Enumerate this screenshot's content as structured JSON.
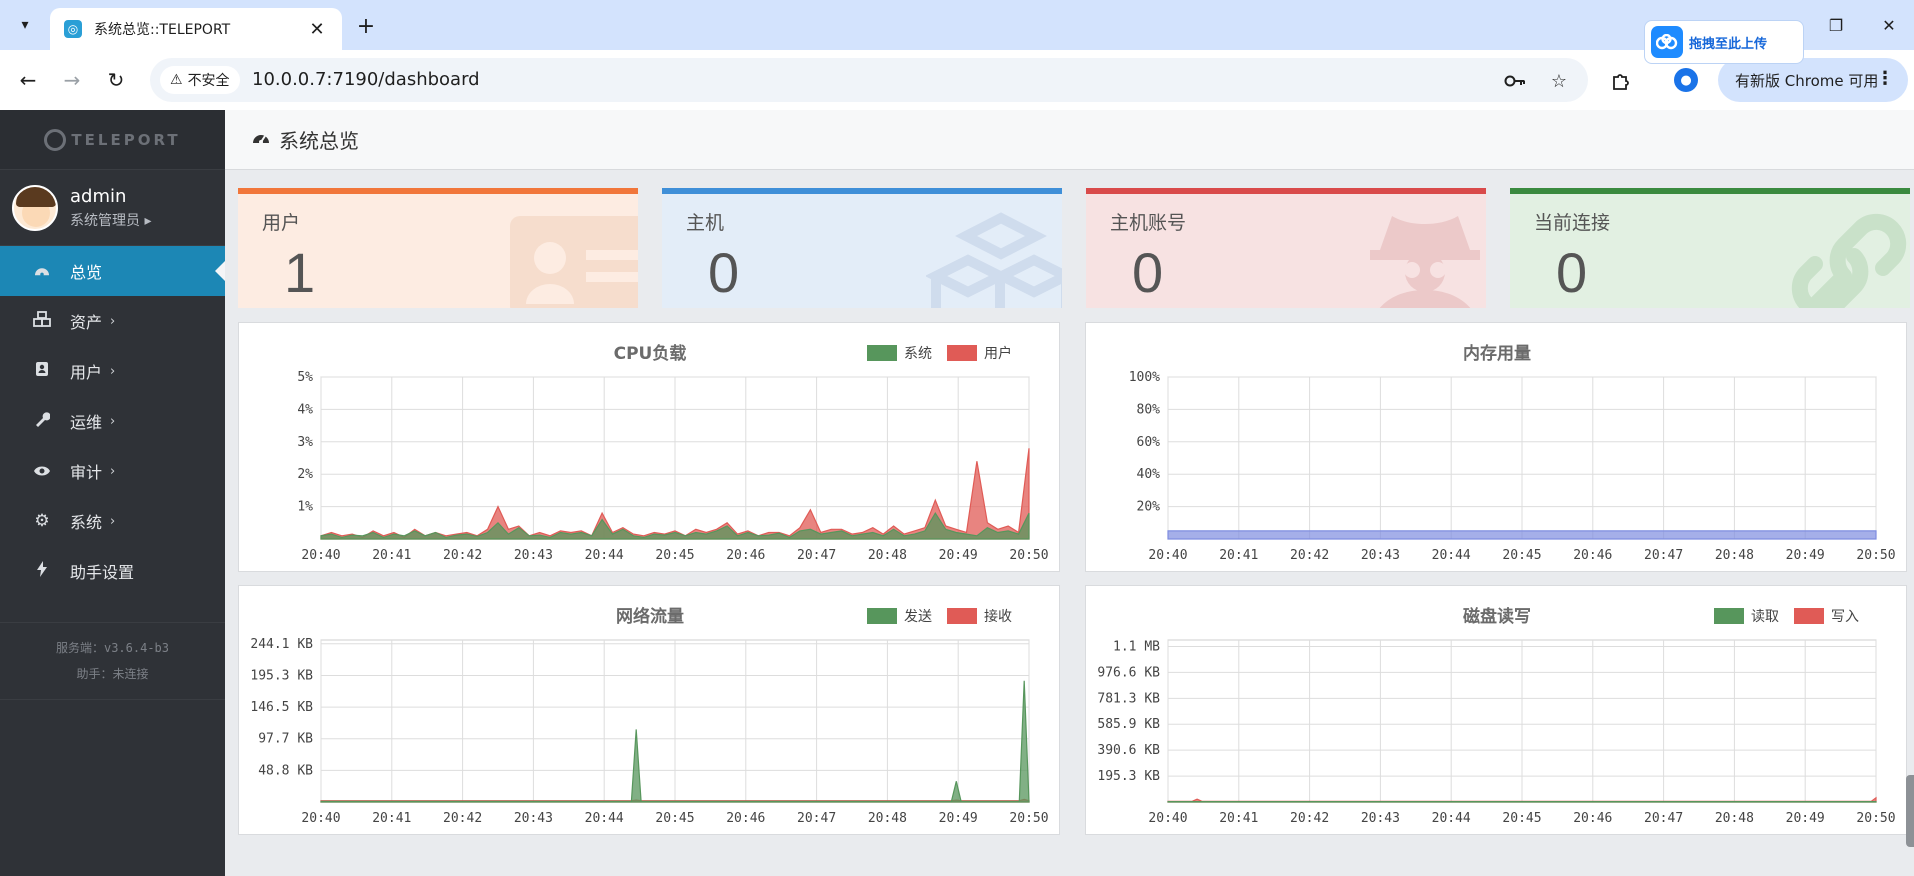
{
  "browser": {
    "tab": {
      "title": "系统总览::TELEPORT"
    },
    "new_tab_symbol": "+",
    "upload_badge": {
      "label": "拖拽至此上传"
    },
    "security_chip": {
      "warn_symbol": "⚠",
      "label": "不安全"
    },
    "url": "10.0.0.7:7190/dashboard",
    "update_pill": {
      "label": "有新版 Chrome 可用"
    }
  },
  "sidebar": {
    "logo_text": "TELEPORT",
    "user": {
      "name": "admin",
      "role": "系统管理员 ▸"
    },
    "items": [
      {
        "label": "总览",
        "icon": "dashboard-icon",
        "caret": "",
        "active": true
      },
      {
        "label": "资产",
        "icon": "cubes-icon",
        "caret": "›",
        "active": false
      },
      {
        "label": "用户",
        "icon": "user-card-icon",
        "caret": "›",
        "active": false
      },
      {
        "label": "运维",
        "icon": "wrench-icon",
        "caret": "›",
        "active": false
      },
      {
        "label": "审计",
        "icon": "eye-icon",
        "caret": "›",
        "active": false
      },
      {
        "label": "系统",
        "icon": "gear-icon",
        "caret": "›",
        "active": false
      },
      {
        "label": "助手设置",
        "icon": "bolt-icon",
        "caret": "",
        "active": false
      }
    ],
    "footer": {
      "server_version": "服务端：v3.6.4-b3",
      "assistant_status": "助手：未连接"
    }
  },
  "page": {
    "title": "系统总览"
  },
  "stats": [
    {
      "label": "用户",
      "value": "1",
      "bar_color": "#f1763a",
      "bg": "#fdece2",
      "icon": "id-card-icon"
    },
    {
      "label": "主机",
      "value": "0",
      "bar_color": "#3f8fd8",
      "bg": "#e3edf8",
      "icon": "cubes-icon"
    },
    {
      "label": "主机账号",
      "value": "0",
      "bar_color": "#d94a4a",
      "bg": "#f7e2e2",
      "icon": "user-secret-icon"
    },
    {
      "label": "当前连接",
      "value": "0",
      "bar_color": "#3a8a3f",
      "bg": "#e2f0e2",
      "icon": "link-icon"
    }
  ],
  "chart_data": [
    {
      "id": "cpu",
      "type": "area",
      "title": "CPU负载",
      "x": [
        "20:40",
        "20:41",
        "20:42",
        "20:43",
        "20:44",
        "20:45",
        "20:46",
        "20:47",
        "20:48",
        "20:49",
        "20:50"
      ],
      "yticks": [
        "5%",
        "4%",
        "3%",
        "2%",
        "1%"
      ],
      "ylim": [
        0,
        5
      ],
      "legend": "top-right",
      "series": [
        {
          "name": "系统",
          "color": "#57965c",
          "values": [
            0.1,
            0.15,
            0.05,
            0.12,
            0.1,
            0.2,
            0.05,
            0.15,
            0.1,
            0.25,
            0.1,
            0.2,
            0.05,
            0.12,
            0.15,
            0.08,
            0.2,
            0.5,
            0.15,
            0.35,
            0.1,
            0.12,
            0.05,
            0.2,
            0.15,
            0.2,
            0.1,
            0.6,
            0.15,
            0.3,
            0.1,
            0.05,
            0.15,
            0.12,
            0.2,
            0.1,
            0.2,
            0.15,
            0.25,
            0.4,
            0.1,
            0.2,
            0.1,
            0.12,
            0.18,
            0.05,
            0.25,
            0.3,
            0.15,
            0.2,
            0.25,
            0.1,
            0.15,
            0.2,
            0.1,
            0.3,
            0.1,
            0.15,
            0.25,
            0.8,
            0.3,
            0.2,
            0.15,
            0.1,
            0.35,
            0.2,
            0.25,
            0.15,
            0.8
          ]
        },
        {
          "name": "用户",
          "color": "#e05b56",
          "values": [
            0.1,
            0.2,
            0.1,
            0.15,
            0.05,
            0.25,
            0.1,
            0.2,
            0.05,
            0.3,
            0.1,
            0.2,
            0.1,
            0.15,
            0.2,
            0.1,
            0.3,
            1.0,
            0.3,
            0.4,
            0.1,
            0.2,
            0.1,
            0.25,
            0.2,
            0.25,
            0.1,
            0.8,
            0.2,
            0.35,
            0.15,
            0.1,
            0.2,
            0.15,
            0.25,
            0.1,
            0.3,
            0.2,
            0.3,
            0.5,
            0.15,
            0.25,
            0.1,
            0.2,
            0.2,
            0.1,
            0.35,
            0.9,
            0.2,
            0.3,
            0.3,
            0.15,
            0.2,
            0.35,
            0.15,
            0.4,
            0.15,
            0.25,
            0.35,
            1.2,
            0.4,
            0.3,
            0.2,
            2.4,
            0.5,
            0.3,
            0.4,
            0.2,
            2.8
          ]
        }
      ]
    },
    {
      "id": "mem",
      "type": "area",
      "title": "内存用量",
      "x": [
        "20:40",
        "20:41",
        "20:42",
        "20:43",
        "20:44",
        "20:45",
        "20:46",
        "20:47",
        "20:48",
        "20:49",
        "20:50"
      ],
      "yticks": [
        "100%",
        "80%",
        "60%",
        "40%",
        "20%"
      ],
      "ylim": [
        0,
        100
      ],
      "series": [
        {
          "name": "",
          "color": "#7f8de0",
          "values": [
            5,
            5,
            5,
            5,
            5,
            5,
            5,
            5,
            5,
            5,
            5
          ]
        }
      ]
    },
    {
      "id": "net",
      "type": "area",
      "title": "网络流量",
      "x": [
        "20:40",
        "20:41",
        "20:42",
        "20:43",
        "20:44",
        "20:45",
        "20:46",
        "20:47",
        "20:48",
        "20:49",
        "20:50"
      ],
      "yticks": [
        "244.1 KB",
        "195.3 KB",
        "146.5 KB",
        "97.7 KB",
        "48.8 KB"
      ],
      "ylim": [
        0,
        250
      ],
      "legend": "top-right",
      "series": [
        {
          "name": "发送",
          "color": "#57965c",
          "values": [
            1,
            1,
            1,
            1,
            1,
            1,
            1,
            1,
            1,
            1,
            1,
            1,
            1,
            1,
            1,
            1,
            1,
            1,
            1,
            1,
            1,
            1,
            1,
            1,
            1,
            1,
            1,
            1,
            1,
            1,
            1,
            1,
            1,
            1,
            1,
            1,
            1,
            1,
            1,
            1,
            1,
            1,
            1,
            1,
            1,
            1,
            1,
            1,
            1,
            1,
            1,
            1,
            1,
            1,
            1,
            1,
            1,
            1,
            1,
            1,
            1,
            1,
            1,
            1,
            1,
            112,
            1,
            1,
            1,
            1,
            1,
            1,
            1,
            1,
            1,
            1,
            1,
            1,
            1,
            1,
            1,
            1,
            1,
            1,
            1,
            1,
            1,
            1,
            1,
            1,
            1,
            1,
            1,
            1,
            1,
            1,
            1,
            1,
            1,
            1,
            1,
            1,
            1,
            1,
            1,
            1,
            1,
            1,
            1,
            1,
            1,
            1,
            1,
            1,
            1,
            1,
            1,
            1,
            1,
            1,
            1,
            1,
            1,
            1,
            1,
            1,
            1,
            1,
            1,
            1,
            1,
            32,
            1,
            1,
            1,
            1,
            1,
            1,
            1,
            1,
            1,
            1,
            1,
            1,
            1,
            187,
            1
          ]
        },
        {
          "name": "接收",
          "color": "#e05b56",
          "values": [
            2,
            2,
            2,
            2,
            2,
            2,
            2,
            2,
            2,
            2,
            2,
            2,
            2,
            2,
            2,
            2,
            2,
            2,
            2,
            2,
            2,
            2,
            2,
            2,
            2,
            2,
            2,
            2,
            2,
            2,
            2,
            2,
            2,
            2,
            2,
            2,
            2,
            2,
            2,
            2,
            2,
            2,
            2,
            2,
            2,
            2,
            2,
            2,
            2,
            2,
            2,
            2,
            2,
            2,
            2,
            2,
            2,
            2,
            2,
            2,
            2,
            2,
            2,
            2,
            2,
            3,
            2,
            2,
            2,
            2,
            2,
            2,
            2,
            2,
            2,
            2,
            2,
            2,
            2,
            2,
            2,
            2,
            2,
            2,
            2,
            2,
            2,
            2,
            2,
            2,
            2,
            2,
            2,
            2,
            2,
            2,
            2,
            2,
            2,
            2,
            2,
            2,
            2,
            2,
            2,
            2,
            2,
            2,
            2,
            2,
            2,
            2,
            2,
            2,
            2,
            2,
            2,
            2,
            2,
            2,
            2,
            2,
            2,
            2,
            2,
            2,
            2,
            2,
            2,
            2,
            2,
            3,
            2,
            2,
            2,
            2,
            2,
            2,
            2,
            2,
            2,
            2,
            2,
            2,
            2,
            4,
            2
          ]
        }
      ]
    },
    {
      "id": "disk",
      "type": "area",
      "title": "磁盘读写",
      "x": [
        "20:40",
        "20:41",
        "20:42",
        "20:43",
        "20:44",
        "20:45",
        "20:46",
        "20:47",
        "20:48",
        "20:49",
        "20:50"
      ],
      "yticks": [
        "1.1 MB",
        "976.6 KB",
        "781.3 KB",
        "585.9 KB",
        "390.6 KB",
        "195.3 KB"
      ],
      "ylim": [
        0,
        1150
      ],
      "legend": "top-right",
      "series": [
        {
          "name": "读取",
          "color": "#57965c",
          "values": [
            3,
            3,
            3,
            3,
            3,
            3,
            3,
            3,
            3,
            3,
            3,
            3,
            3,
            3,
            3,
            3,
            3,
            3,
            3,
            3,
            3,
            3,
            3,
            3,
            3,
            3,
            3,
            3,
            3,
            3,
            3,
            3,
            3,
            3,
            3,
            3,
            3,
            3,
            3,
            3,
            3,
            3,
            3,
            3,
            3,
            3,
            3,
            3,
            3,
            3,
            3,
            3,
            3,
            3,
            3,
            3,
            3,
            3,
            3,
            3,
            3,
            3,
            3,
            3,
            3,
            3,
            3,
            3,
            3,
            3,
            3,
            3,
            3,
            3,
            3,
            3,
            3,
            3,
            3,
            3,
            3,
            3,
            3,
            3,
            3,
            3,
            3,
            3,
            3,
            3,
            3,
            3,
            3,
            3,
            3,
            3,
            3,
            3,
            3,
            3,
            3,
            3,
            3,
            3,
            3,
            3,
            3,
            3,
            3,
            3,
            3,
            3,
            3,
            3,
            3,
            3,
            3,
            3,
            3,
            3,
            3,
            3,
            3,
            3,
            3,
            3,
            3,
            3,
            3,
            3,
            3,
            3,
            3,
            3,
            3,
            3,
            3,
            3,
            3,
            3,
            3,
            3,
            3,
            3,
            3,
            3,
            3
          ]
        },
        {
          "name": "写入",
          "color": "#e05b56",
          "values": [
            5,
            5,
            5,
            5,
            5,
            5,
            20,
            5,
            5,
            5,
            5,
            5,
            5,
            5,
            5,
            5,
            5,
            5,
            5,
            5,
            5,
            5,
            5,
            5,
            5,
            5,
            5,
            5,
            5,
            5,
            5,
            5,
            5,
            5,
            5,
            5,
            5,
            5,
            5,
            5,
            5,
            5,
            5,
            5,
            5,
            5,
            5,
            5,
            5,
            5,
            5,
            5,
            5,
            5,
            5,
            5,
            5,
            5,
            5,
            5,
            5,
            5,
            5,
            5,
            5,
            5,
            5,
            5,
            5,
            5,
            5,
            5,
            5,
            5,
            5,
            5,
            5,
            5,
            5,
            5,
            5,
            5,
            5,
            5,
            5,
            5,
            5,
            5,
            5,
            5,
            5,
            5,
            5,
            5,
            5,
            5,
            5,
            5,
            5,
            5,
            5,
            5,
            5,
            5,
            5,
            5,
            5,
            5,
            5,
            5,
            5,
            5,
            5,
            5,
            5,
            5,
            5,
            5,
            5,
            5,
            5,
            5,
            5,
            5,
            5,
            5,
            5,
            5,
            5,
            5,
            5,
            5,
            5,
            5,
            5,
            5,
            5,
            5,
            5,
            5,
            5,
            5,
            5,
            5,
            5,
            5,
            30
          ]
        }
      ]
    }
  ]
}
